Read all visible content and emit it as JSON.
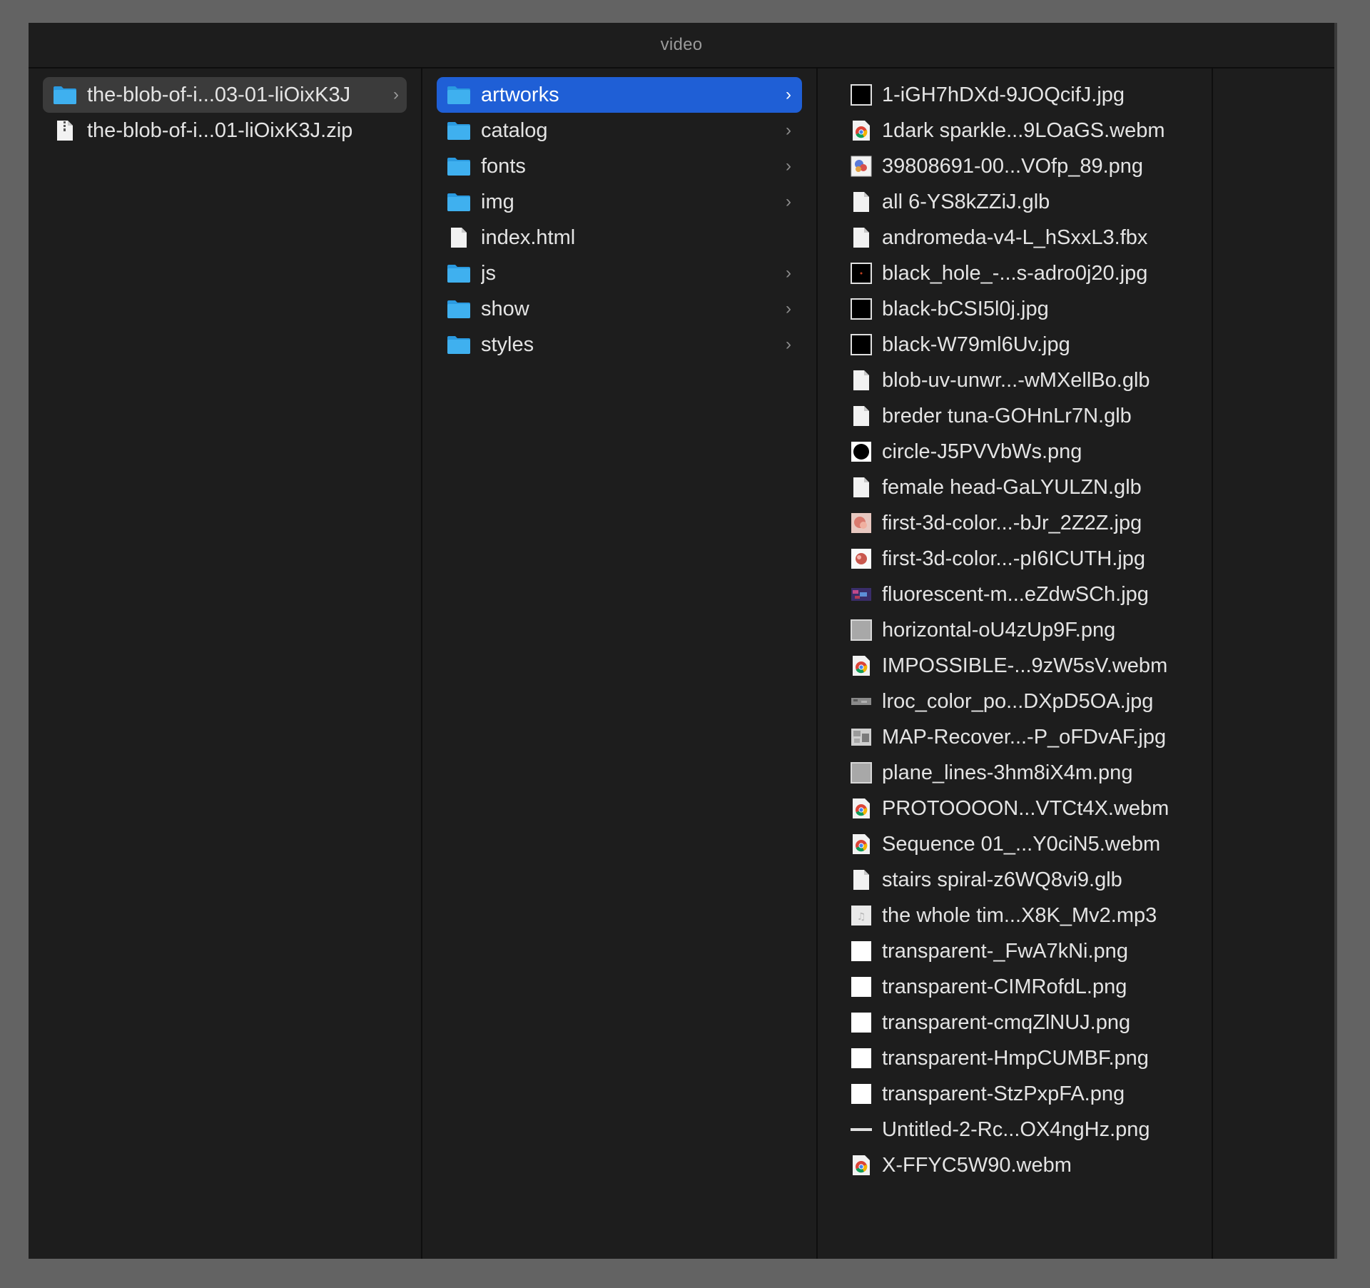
{
  "window": {
    "title": "video"
  },
  "column1": {
    "items": [
      {
        "name": "the-blob-of-i...03-01-liOixK3J",
        "kind": "folder",
        "icon": "folder-icon",
        "selected": "gray",
        "chevron": true
      },
      {
        "name": "the-blob-of-i...01-liOixK3J.zip",
        "kind": "zip",
        "icon": "zip-file-icon",
        "selected": "",
        "chevron": false
      }
    ]
  },
  "column2": {
    "items": [
      {
        "name": "artworks",
        "kind": "folder",
        "icon": "folder-icon",
        "selected": "blue",
        "chevron": true
      },
      {
        "name": "catalog",
        "kind": "folder",
        "icon": "folder-icon",
        "selected": "",
        "chevron": true
      },
      {
        "name": "fonts",
        "kind": "folder",
        "icon": "folder-icon",
        "selected": "",
        "chevron": true
      },
      {
        "name": "img",
        "kind": "folder",
        "icon": "folder-icon",
        "selected": "",
        "chevron": true
      },
      {
        "name": "index.html",
        "kind": "doc",
        "icon": "html-file-icon",
        "selected": "",
        "chevron": false
      },
      {
        "name": "js",
        "kind": "folder",
        "icon": "folder-icon",
        "selected": "",
        "chevron": true
      },
      {
        "name": "show",
        "kind": "folder",
        "icon": "folder-icon",
        "selected": "",
        "chevron": true
      },
      {
        "name": "styles",
        "kind": "folder",
        "icon": "folder-icon",
        "selected": "",
        "chevron": true
      }
    ]
  },
  "column3": {
    "items": [
      {
        "name": "1-iGH7hDXd-9JOQcifJ.jpg",
        "kind": "thumb-black",
        "icon": "image-thumbnail-icon"
      },
      {
        "name": "1dark sparkle...9LOaGS.webm",
        "kind": "chrome",
        "icon": "chrome-webm-icon"
      },
      {
        "name": "39808691-00...VOfp_89.png",
        "kind": "thumb-color",
        "icon": "image-thumbnail-icon"
      },
      {
        "name": "all 6-YS8kZZiJ.glb",
        "kind": "doc",
        "icon": "file-icon"
      },
      {
        "name": "andromeda-v4-L_hSxxL3.fbx",
        "kind": "doc",
        "icon": "file-icon"
      },
      {
        "name": "black_hole_-...s-adro0j20.jpg",
        "kind": "thumb-blackhole",
        "icon": "image-thumbnail-icon"
      },
      {
        "name": "black-bCSI5l0j.jpg",
        "kind": "thumb-black",
        "icon": "image-thumbnail-icon"
      },
      {
        "name": "black-W79ml6Uv.jpg",
        "kind": "thumb-black",
        "icon": "image-thumbnail-icon"
      },
      {
        "name": "blob-uv-unwr...-wMXellBo.glb",
        "kind": "doc",
        "icon": "file-icon"
      },
      {
        "name": "breder tuna-GOHnLr7N.glb",
        "kind": "doc",
        "icon": "file-icon"
      },
      {
        "name": "circle-J5PVVbWs.png",
        "kind": "thumb-circle",
        "icon": "image-thumbnail-icon"
      },
      {
        "name": "female head-GaLYULZN.glb",
        "kind": "doc",
        "icon": "file-icon"
      },
      {
        "name": "first-3d-color...-bJr_2Z2Z.jpg",
        "kind": "thumb-pink",
        "icon": "image-thumbnail-icon"
      },
      {
        "name": "first-3d-color...-pI6ICUTH.jpg",
        "kind": "thumb-pinkdark",
        "icon": "image-thumbnail-icon"
      },
      {
        "name": "fluorescent-m...eZdwSCh.jpg",
        "kind": "thumb-fluor",
        "icon": "image-thumbnail-icon"
      },
      {
        "name": "horizontal-oU4zUp9F.png",
        "kind": "thumb-gray",
        "icon": "image-thumbnail-icon"
      },
      {
        "name": "IMPOSSIBLE-...9zW5sV.webm",
        "kind": "chrome",
        "icon": "chrome-webm-icon"
      },
      {
        "name": "lroc_color_po...DXpD5OA.jpg",
        "kind": "thumb-moon",
        "icon": "image-thumbnail-icon"
      },
      {
        "name": "MAP-Recover...-P_oFDvAF.jpg",
        "kind": "thumb-map",
        "icon": "image-thumbnail-icon"
      },
      {
        "name": "plane_lines-3hm8iX4m.png",
        "kind": "thumb-gray",
        "icon": "image-thumbnail-icon"
      },
      {
        "name": "PROTOOOON...VTCt4X.webm",
        "kind": "chrome",
        "icon": "chrome-webm-icon"
      },
      {
        "name": "Sequence 01_...Y0ciN5.webm",
        "kind": "chrome",
        "icon": "chrome-webm-icon"
      },
      {
        "name": "stairs spiral-z6WQ8vi9.glb",
        "kind": "doc",
        "icon": "file-icon"
      },
      {
        "name": "the whole tim...X8K_Mv2.mp3",
        "kind": "audio",
        "icon": "audio-file-icon"
      },
      {
        "name": "transparent-_FwA7kNi.png",
        "kind": "thumb-white",
        "icon": "image-thumbnail-icon"
      },
      {
        "name": "transparent-CIMRofdL.png",
        "kind": "thumb-white",
        "icon": "image-thumbnail-icon"
      },
      {
        "name": "transparent-cmqZlNUJ.png",
        "kind": "thumb-white",
        "icon": "image-thumbnail-icon"
      },
      {
        "name": "transparent-HmpCUMBF.png",
        "kind": "thumb-white",
        "icon": "image-thumbnail-icon"
      },
      {
        "name": "transparent-StzPxpFA.png",
        "kind": "thumb-white",
        "icon": "image-thumbnail-icon"
      },
      {
        "name": "Untitled-2-Rc...OX4ngHz.png",
        "kind": "thumb-line",
        "icon": "image-thumbnail-icon"
      },
      {
        "name": "X-FFYC5W90.webm",
        "kind": "chrome",
        "icon": "chrome-webm-icon"
      }
    ]
  },
  "colors": {
    "selection_blue": "#1f5fd6",
    "selection_gray": "#3b3b3b",
    "folder_blue": "#3fb0ef",
    "background": "#1d1d1d",
    "text": "#e4e4e4"
  }
}
